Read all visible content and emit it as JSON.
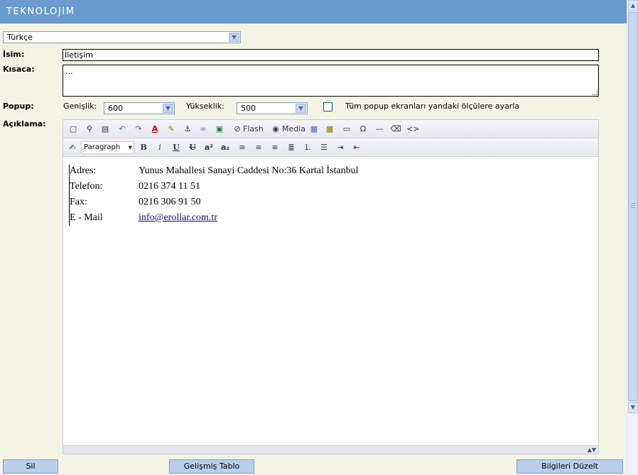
{
  "header": {
    "logo": "TEKNOLOJIM"
  },
  "language_select": {
    "value": "Türkçe"
  },
  "form": {
    "name_label": "İsim:",
    "name_value": "İletişim",
    "summary_label": "Kısaca:",
    "summary_value": "...",
    "popup_label": "Popup:",
    "width_label": "Genişlik:",
    "width_value": "600",
    "height_label": "Yükseklik:",
    "height_value": "500",
    "popup_checkbox_label": "Tüm popup ekranları yandaki ölçülere ayarla",
    "description_label": "Açıklama:"
  },
  "editor": {
    "toolbar1": {
      "flash_label": "Flash",
      "media_label": "Media"
    },
    "toolbar2": {
      "format_value": "Paragraph",
      "bold": "B",
      "italic": "i",
      "underline": "U",
      "strike": "U",
      "superscript": "a²",
      "subscript": "a₂"
    },
    "content": [
      {
        "key": "Adres:",
        "value": "Yunus Mahallesi Sanayi Caddesi No:36  Kartal  İstanbul"
      },
      {
        "key": "Telefon:",
        "value": "0216 374 11 51"
      },
      {
        "key": "Fax:",
        "value": "0216 306 91 50"
      },
      {
        "key": "E - Mail",
        "value": "info@erollar.com.tr"
      }
    ]
  },
  "buttons": {
    "delete": "Sil",
    "advanced_table": "Gelişmiş Tablo",
    "update": "Bilgileri Düzelt"
  },
  "colors": {
    "header_bg": "#6b9bcc",
    "page_bg": "#f4f4e4",
    "button_bg": "#b9cfea"
  }
}
